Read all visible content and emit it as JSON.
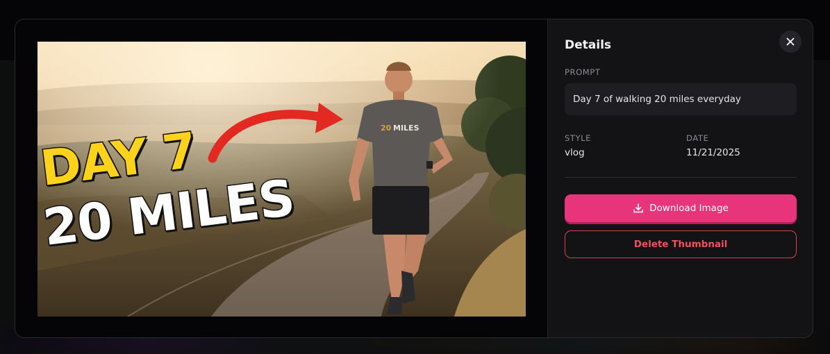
{
  "colors": {
    "accent": "#e8347a",
    "danger": "#f0525b",
    "panel": "#131316",
    "thumb_yellow": "#ffd21c"
  },
  "thumbnail": {
    "line1": "DAY 7",
    "line2": "20 MILES",
    "shirt_number": "20",
    "shirt_text": "MILES"
  },
  "details": {
    "title": "Details",
    "close_icon": "close-icon",
    "prompt_label": "PROMPT",
    "prompt_value": "Day 7 of walking 20 miles everyday",
    "style_label": "STYLE",
    "style_value": "vlog",
    "date_label": "DATE",
    "date_value": "11/21/2025",
    "download_label": "Download Image",
    "download_icon": "download-icon",
    "delete_label": "Delete Thumbnail"
  }
}
